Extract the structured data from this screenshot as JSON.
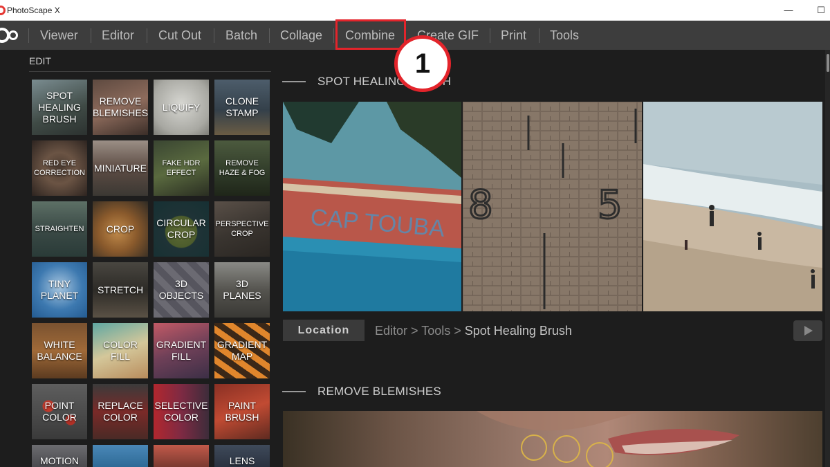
{
  "window": {
    "title": "PhotoScape X",
    "minimize_glyph": "—",
    "maximize_glyph": "☐"
  },
  "menu": {
    "items": [
      {
        "id": "viewer",
        "label": "Viewer"
      },
      {
        "id": "editor",
        "label": "Editor"
      },
      {
        "id": "cutout",
        "label": "Cut Out"
      },
      {
        "id": "batch",
        "label": "Batch"
      },
      {
        "id": "collage",
        "label": "Collage"
      },
      {
        "id": "combine",
        "label": "Combine"
      },
      {
        "id": "creategif",
        "label": "Create GIF"
      },
      {
        "id": "print",
        "label": "Print"
      },
      {
        "id": "tools",
        "label": "Tools"
      }
    ]
  },
  "annotation": {
    "number": "1",
    "highlighted_item": "Combine",
    "color": "#e3242b"
  },
  "sidebar": {
    "section_label": "EDIT",
    "tools": [
      [
        "SPOT HEALING BRUSH",
        "REMOVE BLEMISHES",
        "LIQUIFY",
        "CLONE STAMP"
      ],
      [
        "RED EYE CORRECTION",
        "MINIATURE",
        "FAKE HDR EFFECT",
        "REMOVE HAZE & FOG"
      ],
      [
        "STRAIGHTEN",
        "CROP",
        "CIRCULAR CROP",
        "PERSPECTIVE CROP"
      ],
      [
        "TINY PLANET",
        "STRETCH",
        "3D OBJECTS",
        "3D PLANES"
      ],
      [
        "WHITE BALANCE",
        "COLOR FILL",
        "GRADIENT FILL",
        "GRADIENT MAP"
      ],
      [
        "POINT COLOR",
        "REPLACE COLOR",
        "SELECTIVE COLOR",
        "PAINT BRUSH"
      ],
      [
        "MOTION",
        "",
        "",
        "LENS"
      ]
    ]
  },
  "main": {
    "section1": {
      "title": "SPOT HEALING BRUSH",
      "photo_texts": {
        "boat_name": "CAP TOUBA",
        "wall_left_number": "8",
        "wall_right_number": "5"
      },
      "location_button": "Location",
      "breadcrumb": {
        "part1": "Editor",
        "sep1": " > ",
        "part2": "Tools",
        "sep2": " > ",
        "current": "Spot Healing Brush"
      }
    },
    "section2": {
      "title": "REMOVE BLEMISHES"
    }
  },
  "colors": {
    "menubar_bg": "#3d3d3d",
    "app_bg": "#1d1d1d",
    "menu_text": "#bdbdbd",
    "annotation_red": "#e3242b",
    "logo_red": "#e53935"
  }
}
